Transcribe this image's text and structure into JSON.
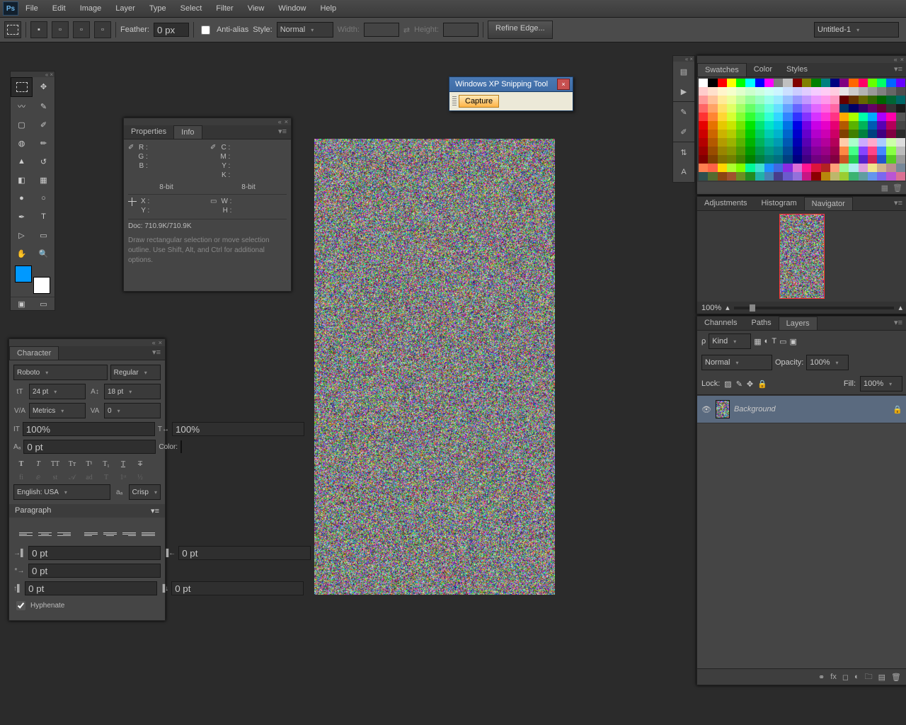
{
  "menu": {
    "items": [
      "File",
      "Edit",
      "Image",
      "Layer",
      "Type",
      "Select",
      "Filter",
      "View",
      "Window",
      "Help"
    ]
  },
  "options": {
    "feather_label": "Feather:",
    "feather_value": "0 px",
    "antialias": "Anti-alias",
    "style_label": "Style:",
    "style_value": "Normal",
    "width_label": "Width:",
    "height_label": "Height:",
    "refine": "Refine Edge...",
    "doc_name": "Untitled-1"
  },
  "info": {
    "tab_props": "Properties",
    "tab_info": "Info",
    "r": "R :",
    "g": "G :",
    "b": "B :",
    "bit8": "8-bit",
    "c": "C :",
    "m": "M :",
    "y": "Y :",
    "k": "K :",
    "x": "X :",
    "yy": "Y :",
    "w": "W :",
    "h": "H :",
    "doc": "Doc: 710.9K/710.9K",
    "hint": "Draw rectangular selection or move selection outline.  Use Shift, Alt, and Ctrl for additional options."
  },
  "character": {
    "title": "Character",
    "font": "Roboto",
    "style": "Regular",
    "size": "24 pt",
    "leading": "18 pt",
    "kerning": "Metrics",
    "tracking": "0",
    "vscale": "100%",
    "hscale": "100%",
    "baseline": "0 pt",
    "color_label": "Color:",
    "color": "#0099ff",
    "lang": "English: USA",
    "aa": "Crisp"
  },
  "paragraph": {
    "title": "Paragraph",
    "indL": "0 pt",
    "indR": "0 pt",
    "indFL": "0 pt",
    "spB": "0 pt",
    "spA": "0 pt",
    "hyphen": "Hyphenate"
  },
  "swatches": {
    "tabs": [
      "Swatches",
      "Color",
      "Styles"
    ]
  },
  "adjust": {
    "tabs": [
      "Adjustments",
      "Histogram",
      "Navigator"
    ],
    "zoom": "100%"
  },
  "layers": {
    "tabs": [
      "Channels",
      "Paths",
      "Layers"
    ],
    "kind": "Kind",
    "blend": "Normal",
    "opacity_label": "Opacity:",
    "opacity": "100%",
    "lock_label": "Lock:",
    "fill_label": "Fill:",
    "fill": "100%",
    "layer_name": "Background"
  },
  "snip": {
    "title": "Windows XP Snipping Tool",
    "capture": "Capture"
  },
  "swatch_colors": [
    "#ffffff",
    "#000000",
    "#ff0000",
    "#ffff00",
    "#00ff00",
    "#00ffff",
    "#0000ff",
    "#ff00ff",
    "#808080",
    "#c0c0c0",
    "#800000",
    "#808000",
    "#008000",
    "#008080",
    "#000080",
    "#800080",
    "#ff6600",
    "#ff0066",
    "#66ff00",
    "#00ff66",
    "#0066ff",
    "#6600ff",
    "#ffcccc",
    "#ffe0cc",
    "#fff5cc",
    "#f5ffcc",
    "#e0ffcc",
    "#ccffcc",
    "#ccffe0",
    "#ccfff5",
    "#ccf5ff",
    "#cce0ff",
    "#ccccff",
    "#e0ccff",
    "#f5ccff",
    "#ffccf5",
    "#ffcce0",
    "#e6e6e6",
    "#cccccc",
    "#b3b3b3",
    "#999999",
    "#808080",
    "#666666",
    "#4d4d4d",
    "#ff9999",
    "#ffc299",
    "#ffeb99",
    "#ebff99",
    "#c2ff99",
    "#99ff99",
    "#99ffc2",
    "#99ffeb",
    "#99ebff",
    "#99c2ff",
    "#9999ff",
    "#c299ff",
    "#eb99ff",
    "#ff99eb",
    "#ff99c2",
    "#660000",
    "#663300",
    "#666600",
    "#336600",
    "#006600",
    "#006633",
    "#006666",
    "#ff6666",
    "#ffa366",
    "#ffe066",
    "#e0ff66",
    "#a3ff66",
    "#66ff66",
    "#66ffa3",
    "#66ffe0",
    "#66e0ff",
    "#66a3ff",
    "#6666ff",
    "#a366ff",
    "#e066ff",
    "#ff66e0",
    "#ff66a3",
    "#003366",
    "#000066",
    "#330066",
    "#660066",
    "#660033",
    "#333333",
    "#1a1a1a",
    "#ff3333",
    "#ff8533",
    "#ffd633",
    "#d6ff33",
    "#85ff33",
    "#33ff33",
    "#33ff85",
    "#33ffd6",
    "#33d6ff",
    "#3385ff",
    "#3333ff",
    "#8533ff",
    "#d633ff",
    "#ff33d6",
    "#ff3385",
    "#ffaa00",
    "#aaff00",
    "#00ffaa",
    "#00aaff",
    "#aa00ff",
    "#ff00aa",
    "#555555",
    "#e60000",
    "#e67300",
    "#e6c800",
    "#c8e600",
    "#73e600",
    "#00e600",
    "#00e673",
    "#00e6c8",
    "#00c8e6",
    "#0073e6",
    "#0000e6",
    "#7300e6",
    "#c800e6",
    "#e600c8",
    "#e60073",
    "#b35900",
    "#59b300",
    "#00b359",
    "#0059b3",
    "#5900b3",
    "#b30059",
    "#444444",
    "#cc0000",
    "#cc6600",
    "#ccb300",
    "#b3cc00",
    "#66cc00",
    "#00cc00",
    "#00cc66",
    "#00ccb3",
    "#00b3cc",
    "#0066cc",
    "#0000cc",
    "#6600cc",
    "#b300cc",
    "#cc00b3",
    "#cc0066",
    "#804000",
    "#408000",
    "#008040",
    "#004080",
    "#400080",
    "#800040",
    "#2a2a2a",
    "#b30000",
    "#b35900",
    "#b39b00",
    "#9bb300",
    "#59b300",
    "#00b300",
    "#00b359",
    "#00b39b",
    "#009bb3",
    "#0059b3",
    "#0000b3",
    "#5900b3",
    "#9b00b3",
    "#b3009b",
    "#b30059",
    "#ffccaa",
    "#aaffcc",
    "#ccaaff",
    "#ffaacc",
    "#aaccff",
    "#ccffaa",
    "#dddddd",
    "#990000",
    "#994d00",
    "#998500",
    "#859900",
    "#4d9900",
    "#009900",
    "#00994d",
    "#009985",
    "#008599",
    "#004d99",
    "#000099",
    "#4d0099",
    "#850099",
    "#990085",
    "#99004d",
    "#ff8844",
    "#44ff88",
    "#8844ff",
    "#ff4488",
    "#4488ff",
    "#88ff44",
    "#bbbbbb",
    "#800000",
    "#804000",
    "#807000",
    "#708000",
    "#408000",
    "#008000",
    "#008040",
    "#008070",
    "#007080",
    "#004080",
    "#000080",
    "#400080",
    "#700080",
    "#800070",
    "#800040",
    "#cc5522",
    "#22cc55",
    "#5522cc",
    "#cc2255",
    "#2255cc",
    "#55cc22",
    "#999999",
    "#ff7f50",
    "#ff6347",
    "#ffd700",
    "#adff2f",
    "#7fff00",
    "#00fa9a",
    "#40e0d0",
    "#1e90ff",
    "#4169e1",
    "#8a2be2",
    "#da70d6",
    "#ff1493",
    "#dc143c",
    "#b22222",
    "#ffa07a",
    "#98fb98",
    "#afeeee",
    "#dda0dd",
    "#f0e68c",
    "#d2b48c",
    "#bc8f8f",
    "#778899",
    "#2f4f4f",
    "#556b2f",
    "#8b4513",
    "#a0522d",
    "#6b8e23",
    "#228b22",
    "#20b2aa",
    "#4682b4",
    "#483d8b",
    "#6a5acd",
    "#9370db",
    "#c71585",
    "#8b0000",
    "#b8860b",
    "#bdb76b",
    "#9acd32",
    "#3cb371",
    "#5f9ea0",
    "#6495ed",
    "#7b68ee",
    "#ba55d3",
    "#db7093"
  ]
}
